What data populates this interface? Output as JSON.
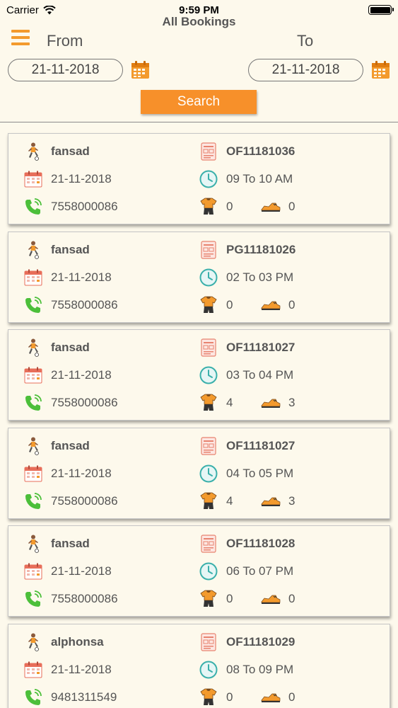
{
  "status_bar": {
    "carrier": "Carrier",
    "time": "9:59 PM"
  },
  "header": {
    "title": "All Bookings",
    "from_label": "From",
    "to_label": "To",
    "from_date": "21-11-2018",
    "to_date": "21-11-2018",
    "search_label": "Search"
  },
  "colors": {
    "accent": "#f7902a",
    "background": "#fdf9ec"
  },
  "bookings": [
    {
      "name": "fansad",
      "id": "OF11181036",
      "date": "21-11-2018",
      "time": "09 To 10 AM",
      "phone": "7558000086",
      "jerseys": "0",
      "shoes": "0"
    },
    {
      "name": "fansad",
      "id": "PG11181026",
      "date": "21-11-2018",
      "time": "02 To 03 PM",
      "phone": "7558000086",
      "jerseys": "0",
      "shoes": "0"
    },
    {
      "name": "fansad",
      "id": "OF11181027",
      "date": "21-11-2018",
      "time": "03 To 04 PM",
      "phone": "7558000086",
      "jerseys": "4",
      "shoes": "3"
    },
    {
      "name": "fansad",
      "id": "OF11181027",
      "date": "21-11-2018",
      "time": "04 To 05 PM",
      "phone": "7558000086",
      "jerseys": "4",
      "shoes": "3"
    },
    {
      "name": "fansad",
      "id": "OF11181028",
      "date": "21-11-2018",
      "time": "06 To 07 PM",
      "phone": "7558000086",
      "jerseys": "0",
      "shoes": "0"
    },
    {
      "name": "alphonsa",
      "id": "OF11181029",
      "date": "21-11-2018",
      "time": "08 To 09 PM",
      "phone": "9481311549",
      "jerseys": "0",
      "shoes": "0"
    }
  ]
}
